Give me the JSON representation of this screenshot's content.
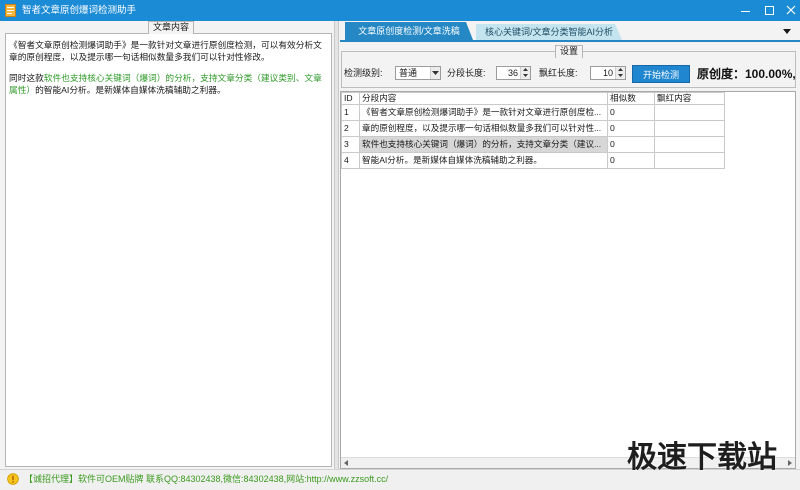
{
  "window": {
    "title": "智者文章原创爆词检测助手",
    "icons": {
      "app": "app-icon",
      "minimize": "minimize-icon",
      "maximize": "maximize-icon",
      "close": "close-icon"
    }
  },
  "left_panel": {
    "label": "文章内容",
    "paragraph1": "《智者文章原创检测爆词助手》是一款针对文章进行原创度检测，可以有效分析文章的原创程度，以及提示哪一句话相似数量多我们可以针对性修改。",
    "paragraph2": {
      "before": "同时这款",
      "highlight": "软件也支持核心关键词（爆词）的分析，支持文章分类（建议类别、文章属性）",
      "after": "的智能AI分析。是新媒体自媒体洗稿辅助之利器。"
    }
  },
  "tabs": [
    {
      "label": "文章原创度检测/文章洗稿",
      "active": true
    },
    {
      "label": "核心关键词/文章分类智能AI分析",
      "active": false
    }
  ],
  "settings": {
    "label": "设置",
    "level_label": "检测级别:",
    "level_value": "普通",
    "segment_label": "分段长度:",
    "segment_value": "36",
    "red_label": "飘红长度:",
    "red_value": "10",
    "start_button": "开始检测",
    "originality": "原创度：100.00%,"
  },
  "table": {
    "columns": [
      "ID",
      "分段内容",
      "相似数",
      "飘红内容"
    ],
    "rows": [
      {
        "id": "1",
        "content": "《智者文章原创检测爆词助手》是一款针对文章进行原创度检...",
        "similar": "0"
      },
      {
        "id": "2",
        "content": "章的原创程度，以及提示哪一句话相似数量多我们可以针对性...",
        "similar": "0"
      },
      {
        "id": "3",
        "content": "软件也支持核心关键词（爆词）的分析，支持文章分类（建议...",
        "similar": "0"
      },
      {
        "id": "4",
        "content": "智能AI分析。是新媒体自媒体洗稿辅助之利器。",
        "similar": "0"
      }
    ],
    "selected_row": 3
  },
  "status_bar": {
    "icon": "warning-icon",
    "text": "【诚招代理】软件可OEM贴牌 联系QQ:84302438,微信:84302438,网站:http://www.zzsoft.cc/"
  },
  "watermark": {
    "text": "极速下载站"
  },
  "colors": {
    "title_bar": "#1c8bd6",
    "active_tab": "#2588c5",
    "inactive_tab": "#c4e4ef",
    "button": "#1f86cf",
    "highlight_text": "#2f9a2a",
    "status_text": "#3a9a1e",
    "selected_cell": "#d7d7d7"
  }
}
